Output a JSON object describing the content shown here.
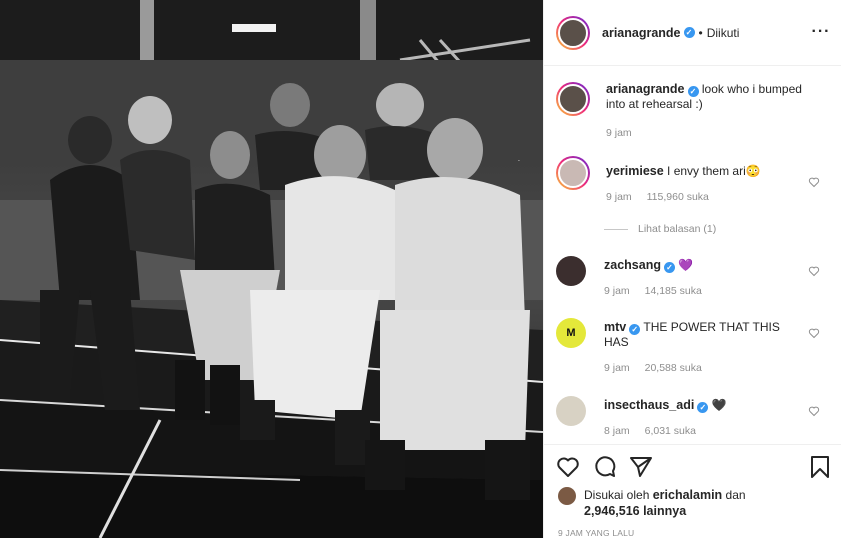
{
  "post": {
    "author": "arianagrande",
    "separator": "•",
    "follow_state": "Diikuti",
    "more_icon": "more-horizontal-icon"
  },
  "caption": {
    "author": "arianagrande",
    "text": "look who i bumped into at rehearsal :)",
    "time": "9 jam"
  },
  "comments": [
    {
      "author": "yerimiese",
      "text": "I envy them ari😳",
      "time": "9 jam",
      "likes": "115,960 suka"
    },
    {
      "author": "zachsang",
      "text": "💜",
      "time": "9 jam",
      "likes": "14,185 suka"
    },
    {
      "author": "mtv",
      "text": "THE POWER THAT THIS HAS",
      "time": "9 jam",
      "likes": "20,588 suka"
    },
    {
      "author": "insecthaus_adi",
      "text": "🖤",
      "time": "8 jam",
      "likes": "6,031 suka"
    }
  ],
  "view_replies": "Lihat balasan (1)",
  "likes": {
    "prefix": "Disukai oleh",
    "user": "erichalamin",
    "conj": "dan",
    "count": "2,946,516 lainnya"
  },
  "timestamp": "9 JAM YANG LALU",
  "colors": {
    "verified": "#3897f0",
    "secondary_text": "#8e8e8e",
    "border": "#efefef"
  },
  "icons": [
    "heart-icon",
    "comment-icon",
    "share-icon",
    "bookmark-icon"
  ]
}
